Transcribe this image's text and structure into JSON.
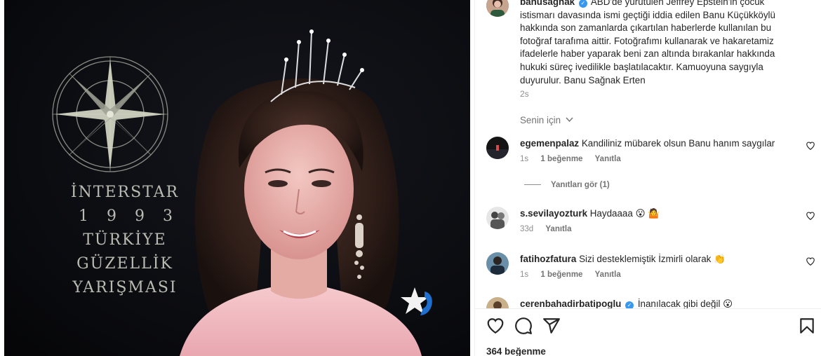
{
  "media": {
    "event_lines": [
      "İNTERSTAR",
      "1993",
      "TÜRKİYE",
      "GÜZELLİK",
      "YARIŞMASI"
    ]
  },
  "post": {
    "username": "banusagnak",
    "caption": "ABD'de yürütülen Jeffrey Epstein'in çocuk istismarı davasında ismi geçtiği iddia edilen Banu Küçükköylü hakkında son zamanlarda çıkartılan haberlerde kullanılan bu fotoğraf tarafıma aittir. Fotoğrafımı kullanarak ve hakaretamiz ifadelerle haber yaparak beni zan altında bırakanlar hakkında hukuki süreç ivedilikle başlatılacaktır. Kamuoyuna saygıyla duyurulur. Banu Sağnak Erten",
    "time": "2s",
    "translation_label": "Senin için"
  },
  "comments": [
    {
      "username": "egemenpalaz",
      "verified": false,
      "text": "Kandiliniz mübarek olsun Banu hanım saygılar",
      "emoji": "",
      "time": "1s",
      "likes": "1 beğenme",
      "reply_label": "Yanıtla"
    },
    {
      "username": "s.sevilayozturk",
      "verified": false,
      "text": "Haydaaaa",
      "emoji": "😮 🤷",
      "time": "33d",
      "likes": "",
      "reply_label": "Yanıtla"
    },
    {
      "username": "fatihozfatura",
      "verified": false,
      "text": "Sizi desteklemiştik İzmirli olarak",
      "emoji": "👏",
      "time": "1s",
      "likes": "1 beğenme",
      "reply_label": "Yanıtla"
    },
    {
      "username": "cerenbahadirbatipoglu",
      "verified": true,
      "text": "İnanılacak gibi değil",
      "emoji": "😮",
      "time": "",
      "likes": "",
      "reply_label": ""
    }
  ],
  "replies_link": "Yanıtları gör (1)",
  "actions": {
    "icons": [
      "heart-icon",
      "comment-icon",
      "share-icon",
      "save-icon"
    ]
  },
  "likes_count": "364 beğenme",
  "colors": {
    "text": "#262626",
    "muted": "#8e8e8e",
    "verified": "#3897f0",
    "link": "#00376b"
  }
}
